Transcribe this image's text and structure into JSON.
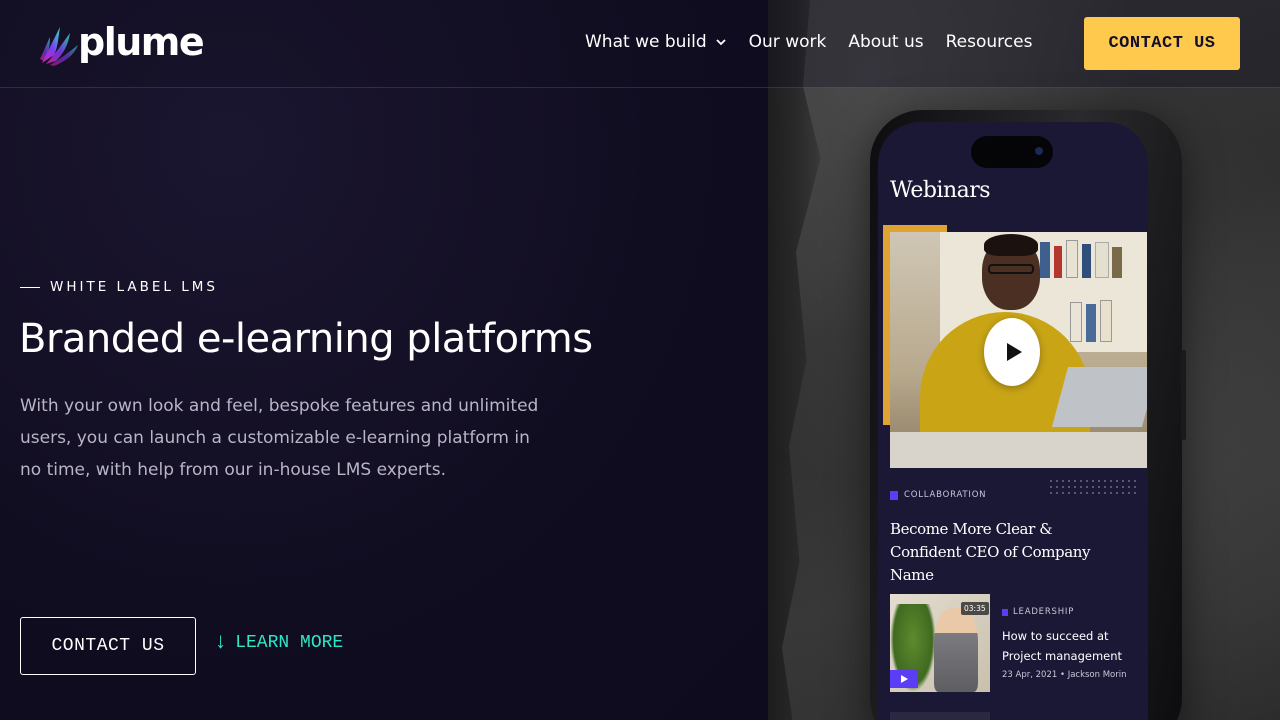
{
  "header": {
    "logo_text": "plume",
    "nav": [
      {
        "label": "What we build",
        "has_dropdown": true
      },
      {
        "label": "Our work"
      },
      {
        "label": "About us"
      },
      {
        "label": "Resources"
      }
    ],
    "cta_label": "CONTACT US"
  },
  "hero": {
    "eyebrow": "WHITE LABEL LMS",
    "title": "Branded e-learning platforms",
    "description": "With your own look and feel, bespoke features and unlimited users, you can launch a customizable e-learning platform in no time, with help from our in-house LMS experts.",
    "primary_button": "CONTACT US",
    "secondary_link": "LEARN MORE",
    "secondary_icon": "arrow-down-icon"
  },
  "phone_screen": {
    "title": "Webinars",
    "featured": {
      "category": "COLLABORATION",
      "headline": "Become More Clear & Confident CEO of Company Name"
    },
    "item": {
      "duration": "03:35",
      "category": "LEADERSHIP",
      "title": "How to succeed at Project management",
      "date": "23 Apr, 2021",
      "author": "Jackson Morin"
    }
  },
  "colors": {
    "background": "#110d21",
    "cta_yellow": "#ffc94d",
    "accent_teal": "#2ee6c8",
    "accent_purple": "#5b3df5",
    "text_muted": "#b9b5c6"
  }
}
